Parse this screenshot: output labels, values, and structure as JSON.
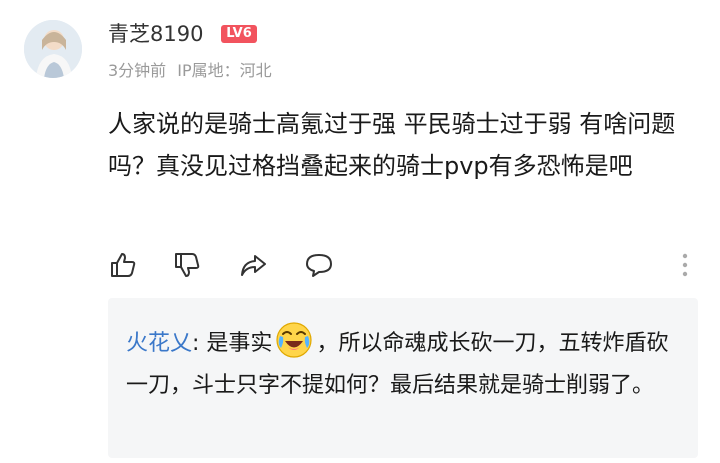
{
  "comment": {
    "username": "青芝8190",
    "level_badge": "LV6",
    "time": "3分钟前",
    "ip_label": "IP属地：河北",
    "content": "人家说的是骑士高氪过于强 平民骑士过于弱 有啥问题吗？真没见过格挡叠起来的骑士pvp有多恐怖是吧"
  },
  "actions": [
    {
      "name": "like",
      "icon": "thumbs-up-icon"
    },
    {
      "name": "dislike",
      "icon": "thumbs-down-icon"
    },
    {
      "name": "share",
      "icon": "share-icon"
    },
    {
      "name": "reply",
      "icon": "comment-icon"
    },
    {
      "name": "more",
      "icon": "more-vertical-icon"
    }
  ],
  "reply": {
    "author": "火花乂",
    "colon": ": ",
    "text_before_emoji": "是事实",
    "emoji": "crying-laughing-emoji",
    "text_after_emoji": "，所以命魂成长砍一刀，五转炸盾砍一刀，斗士只字不提如何？最后结果就是骑士削弱了。"
  },
  "colors": {
    "level_badge": "#f2535e",
    "reply_author": "#3b78c9",
    "meta_text": "#9a9a9a",
    "reply_background": "#f5f6f7"
  }
}
